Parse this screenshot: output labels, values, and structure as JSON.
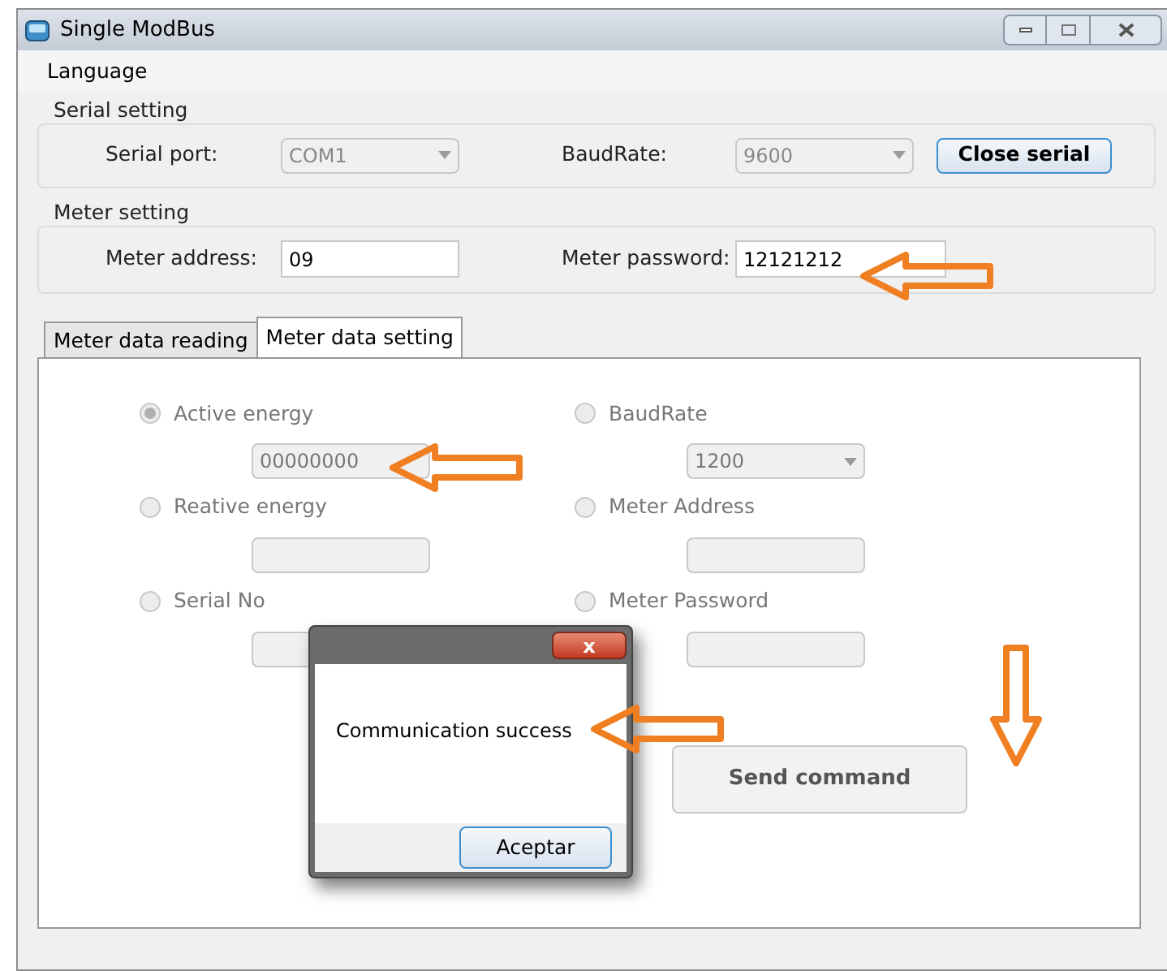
{
  "window": {
    "title": "Single ModBus"
  },
  "menu": [
    "Language"
  ],
  "serial_setting": {
    "title": "Serial setting",
    "port_label": "Serial port:",
    "port": {
      "value": "COM1",
      "disabled": true
    },
    "baud_label": "BaudRate:",
    "baud": {
      "value": "9600",
      "disabled": true
    },
    "button": "Close serial"
  },
  "meter_setting": {
    "title": "Meter setting",
    "address_label": "Meter address:",
    "address": "09",
    "password_label": "Meter password:",
    "password": "12121212"
  },
  "tabs": [
    {
      "label": "Meter data reading",
      "selected": false
    },
    {
      "label": "Meter data setting",
      "selected": true
    }
  ],
  "options": [
    {
      "label": "Active energy",
      "selected": true,
      "field": {
        "kind": "text",
        "value": "00000000"
      }
    },
    {
      "label": "BaudRate",
      "selected": false,
      "field": {
        "kind": "select",
        "value": "1200"
      }
    },
    {
      "label": "Reative energy",
      "selected": false,
      "field": {
        "kind": "text"
      }
    },
    {
      "label": "Meter Address",
      "selected": false,
      "field": {
        "kind": "text"
      }
    },
    {
      "label": "Serial No",
      "selected": false,
      "field": {
        "kind": "text"
      }
    },
    {
      "label": "Meter Password",
      "selected": false,
      "field": {
        "kind": "text"
      }
    }
  ],
  "send_button": "Send command",
  "dialog": {
    "close": "x",
    "message": "Communication success",
    "button": "Aceptar"
  }
}
